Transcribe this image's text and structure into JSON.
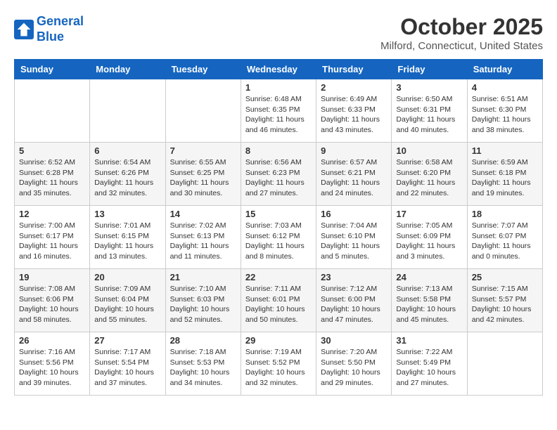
{
  "header": {
    "logo_line1": "General",
    "logo_line2": "Blue",
    "month": "October 2025",
    "location": "Milford, Connecticut, United States"
  },
  "weekdays": [
    "Sunday",
    "Monday",
    "Tuesday",
    "Wednesday",
    "Thursday",
    "Friday",
    "Saturday"
  ],
  "weeks": [
    [
      {
        "day": "",
        "sunrise": "",
        "sunset": "",
        "daylight": ""
      },
      {
        "day": "",
        "sunrise": "",
        "sunset": "",
        "daylight": ""
      },
      {
        "day": "",
        "sunrise": "",
        "sunset": "",
        "daylight": ""
      },
      {
        "day": "1",
        "sunrise": "Sunrise: 6:48 AM",
        "sunset": "Sunset: 6:35 PM",
        "daylight": "Daylight: 11 hours and 46 minutes."
      },
      {
        "day": "2",
        "sunrise": "Sunrise: 6:49 AM",
        "sunset": "Sunset: 6:33 PM",
        "daylight": "Daylight: 11 hours and 43 minutes."
      },
      {
        "day": "3",
        "sunrise": "Sunrise: 6:50 AM",
        "sunset": "Sunset: 6:31 PM",
        "daylight": "Daylight: 11 hours and 40 minutes."
      },
      {
        "day": "4",
        "sunrise": "Sunrise: 6:51 AM",
        "sunset": "Sunset: 6:30 PM",
        "daylight": "Daylight: 11 hours and 38 minutes."
      }
    ],
    [
      {
        "day": "5",
        "sunrise": "Sunrise: 6:52 AM",
        "sunset": "Sunset: 6:28 PM",
        "daylight": "Daylight: 11 hours and 35 minutes."
      },
      {
        "day": "6",
        "sunrise": "Sunrise: 6:54 AM",
        "sunset": "Sunset: 6:26 PM",
        "daylight": "Daylight: 11 hours and 32 minutes."
      },
      {
        "day": "7",
        "sunrise": "Sunrise: 6:55 AM",
        "sunset": "Sunset: 6:25 PM",
        "daylight": "Daylight: 11 hours and 30 minutes."
      },
      {
        "day": "8",
        "sunrise": "Sunrise: 6:56 AM",
        "sunset": "Sunset: 6:23 PM",
        "daylight": "Daylight: 11 hours and 27 minutes."
      },
      {
        "day": "9",
        "sunrise": "Sunrise: 6:57 AM",
        "sunset": "Sunset: 6:21 PM",
        "daylight": "Daylight: 11 hours and 24 minutes."
      },
      {
        "day": "10",
        "sunrise": "Sunrise: 6:58 AM",
        "sunset": "Sunset: 6:20 PM",
        "daylight": "Daylight: 11 hours and 22 minutes."
      },
      {
        "day": "11",
        "sunrise": "Sunrise: 6:59 AM",
        "sunset": "Sunset: 6:18 PM",
        "daylight": "Daylight: 11 hours and 19 minutes."
      }
    ],
    [
      {
        "day": "12",
        "sunrise": "Sunrise: 7:00 AM",
        "sunset": "Sunset: 6:17 PM",
        "daylight": "Daylight: 11 hours and 16 minutes."
      },
      {
        "day": "13",
        "sunrise": "Sunrise: 7:01 AM",
        "sunset": "Sunset: 6:15 PM",
        "daylight": "Daylight: 11 hours and 13 minutes."
      },
      {
        "day": "14",
        "sunrise": "Sunrise: 7:02 AM",
        "sunset": "Sunset: 6:13 PM",
        "daylight": "Daylight: 11 hours and 11 minutes."
      },
      {
        "day": "15",
        "sunrise": "Sunrise: 7:03 AM",
        "sunset": "Sunset: 6:12 PM",
        "daylight": "Daylight: 11 hours and 8 minutes."
      },
      {
        "day": "16",
        "sunrise": "Sunrise: 7:04 AM",
        "sunset": "Sunset: 6:10 PM",
        "daylight": "Daylight: 11 hours and 5 minutes."
      },
      {
        "day": "17",
        "sunrise": "Sunrise: 7:05 AM",
        "sunset": "Sunset: 6:09 PM",
        "daylight": "Daylight: 11 hours and 3 minutes."
      },
      {
        "day": "18",
        "sunrise": "Sunrise: 7:07 AM",
        "sunset": "Sunset: 6:07 PM",
        "daylight": "Daylight: 11 hours and 0 minutes."
      }
    ],
    [
      {
        "day": "19",
        "sunrise": "Sunrise: 7:08 AM",
        "sunset": "Sunset: 6:06 PM",
        "daylight": "Daylight: 10 hours and 58 minutes."
      },
      {
        "day": "20",
        "sunrise": "Sunrise: 7:09 AM",
        "sunset": "Sunset: 6:04 PM",
        "daylight": "Daylight: 10 hours and 55 minutes."
      },
      {
        "day": "21",
        "sunrise": "Sunrise: 7:10 AM",
        "sunset": "Sunset: 6:03 PM",
        "daylight": "Daylight: 10 hours and 52 minutes."
      },
      {
        "day": "22",
        "sunrise": "Sunrise: 7:11 AM",
        "sunset": "Sunset: 6:01 PM",
        "daylight": "Daylight: 10 hours and 50 minutes."
      },
      {
        "day": "23",
        "sunrise": "Sunrise: 7:12 AM",
        "sunset": "Sunset: 6:00 PM",
        "daylight": "Daylight: 10 hours and 47 minutes."
      },
      {
        "day": "24",
        "sunrise": "Sunrise: 7:13 AM",
        "sunset": "Sunset: 5:58 PM",
        "daylight": "Daylight: 10 hours and 45 minutes."
      },
      {
        "day": "25",
        "sunrise": "Sunrise: 7:15 AM",
        "sunset": "Sunset: 5:57 PM",
        "daylight": "Daylight: 10 hours and 42 minutes."
      }
    ],
    [
      {
        "day": "26",
        "sunrise": "Sunrise: 7:16 AM",
        "sunset": "Sunset: 5:56 PM",
        "daylight": "Daylight: 10 hours and 39 minutes."
      },
      {
        "day": "27",
        "sunrise": "Sunrise: 7:17 AM",
        "sunset": "Sunset: 5:54 PM",
        "daylight": "Daylight: 10 hours and 37 minutes."
      },
      {
        "day": "28",
        "sunrise": "Sunrise: 7:18 AM",
        "sunset": "Sunset: 5:53 PM",
        "daylight": "Daylight: 10 hours and 34 minutes."
      },
      {
        "day": "29",
        "sunrise": "Sunrise: 7:19 AM",
        "sunset": "Sunset: 5:52 PM",
        "daylight": "Daylight: 10 hours and 32 minutes."
      },
      {
        "day": "30",
        "sunrise": "Sunrise: 7:20 AM",
        "sunset": "Sunset: 5:50 PM",
        "daylight": "Daylight: 10 hours and 29 minutes."
      },
      {
        "day": "31",
        "sunrise": "Sunrise: 7:22 AM",
        "sunset": "Sunset: 5:49 PM",
        "daylight": "Daylight: 10 hours and 27 minutes."
      },
      {
        "day": "",
        "sunrise": "",
        "sunset": "",
        "daylight": ""
      }
    ]
  ]
}
